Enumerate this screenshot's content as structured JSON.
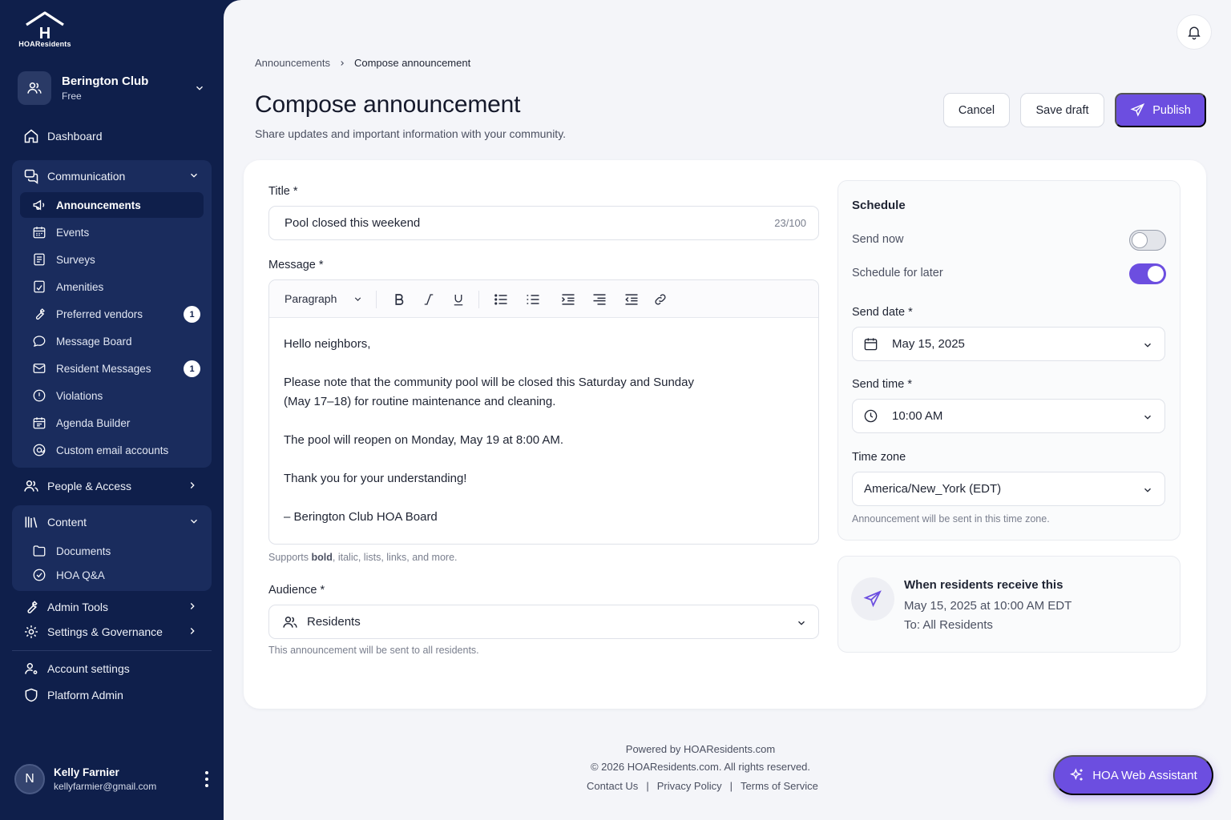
{
  "brand": {
    "logo_text": "HOAResidents"
  },
  "club": {
    "name": "Berington Club",
    "plan": "Free"
  },
  "sidebar": {
    "dashboard": "Dashboard",
    "communication": {
      "label": "Communication",
      "items": [
        {
          "label": "Announcements",
          "icon": "megaphone-icon"
        },
        {
          "label": "Events",
          "icon": "calendar-icon"
        },
        {
          "label": "Surveys",
          "icon": "survey-icon"
        },
        {
          "label": "Amenities",
          "icon": "amenities-icon"
        },
        {
          "label": "Preferred vendors",
          "icon": "wrench-icon",
          "badge": "1"
        },
        {
          "label": "Message Board",
          "icon": "chat-bubble-icon"
        },
        {
          "label": "Resident Messages",
          "icon": "mail-icon",
          "badge": "1"
        },
        {
          "label": "Violations",
          "icon": "alert-circle-icon"
        },
        {
          "label": "Agenda Builder",
          "icon": "agenda-icon"
        },
        {
          "label": "Custom email accounts",
          "icon": "at-sign-icon"
        }
      ]
    },
    "people_access": "People & Access",
    "content": {
      "label": "Content",
      "items": [
        {
          "label": "Documents",
          "icon": "folder-icon"
        },
        {
          "label": "HOA Q&A",
          "icon": "qa-icon"
        }
      ]
    },
    "admin_tools": "Admin Tools",
    "settings_governance": "Settings & Governance",
    "account_settings": "Account settings",
    "platform_admin": "Platform Admin"
  },
  "user": {
    "initial": "N",
    "name": "Kelly Farnier",
    "email": "kellyfarmier@gmail.com"
  },
  "breadcrumb": {
    "parent": "Announcements",
    "current": "Compose announcement"
  },
  "page": {
    "title": "Compose announcement",
    "subtitle": "Share updates and important information with your community."
  },
  "actions": {
    "cancel": "Cancel",
    "save_draft": "Save draft",
    "publish": "Publish"
  },
  "form": {
    "title_label": "Title *",
    "title_value": "Pool closed this weekend",
    "title_counter": "23/100",
    "message_label": "Message *",
    "format_select": "Paragraph",
    "message_lines": [
      "Hello neighbors,",
      "Please note that the community pool will be closed this Saturday and Sunday (May 17–18) for routine maintenance and cleaning.",
      "The pool will reopen on Monday, May 19 at 8:00 AM.",
      "Thank you for your understanding!",
      "– Berington Club HOA Board"
    ],
    "message_hint_prefix": "Supports ",
    "message_hint_bold": "bold",
    "message_hint_suffix": ", italic, lists, links, and more.",
    "audience_label": "Audience *",
    "audience_value": "Residents",
    "audience_hint": "This announcement will be sent to all residents."
  },
  "schedule": {
    "title": "Schedule",
    "send_now": "Send now",
    "send_now_on": false,
    "schedule_later": "Schedule for later",
    "schedule_later_on": true,
    "send_date_label": "Send date *",
    "send_date": "May 15, 2025",
    "send_time_label": "Send time *",
    "send_time": "10:00 AM",
    "timezone_label": "Time zone",
    "timezone": "America/New_York (EDT)",
    "timezone_hint": "Announcement will be sent in this time zone."
  },
  "receive": {
    "title": "When residents receive this",
    "when": "May 15, 2025 at 10:00 AM EDT",
    "to": "To: All Residents"
  },
  "footer": {
    "powered": "Powered by HOAResidents.com",
    "copyright": "© 2026 HOAResidents.com. All rights reserved.",
    "contact": "Contact Us",
    "privacy": "Privacy Policy",
    "terms": "Terms of Service",
    "separator": "|"
  },
  "assistant": {
    "label": "HOA Web Assistant"
  },
  "colors": {
    "sidebar": "#0f1f4b",
    "accent": "#6c4ee0",
    "background": "#f4f5f9"
  }
}
